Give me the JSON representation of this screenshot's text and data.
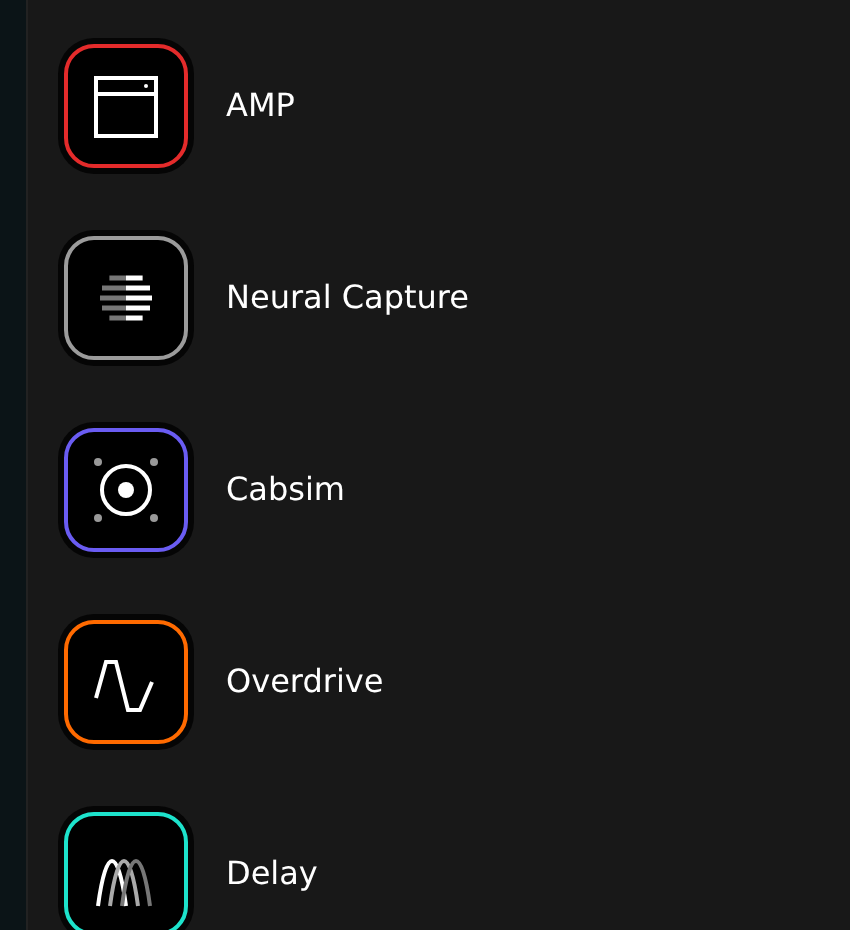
{
  "effects": [
    {
      "kind": "amp",
      "label": "AMP",
      "color": "#e42b2b"
    },
    {
      "kind": "capture",
      "label": "Neural Capture",
      "color": "#9b9b9b"
    },
    {
      "kind": "cabsim",
      "label": "Cabsim",
      "color": "#6a5cf2"
    },
    {
      "kind": "overdrive",
      "label": "Overdrive",
      "color": "#ff6a00"
    },
    {
      "kind": "delay",
      "label": "Delay",
      "color": "#1de3cc"
    }
  ]
}
